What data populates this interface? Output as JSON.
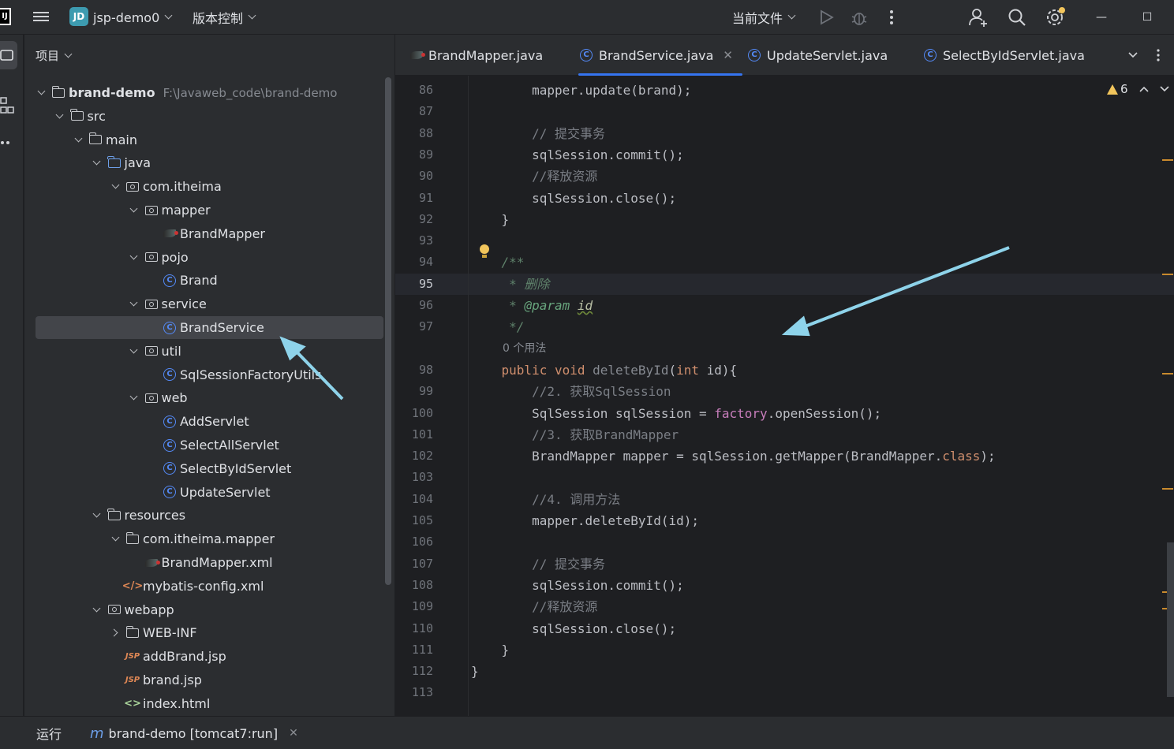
{
  "topbar": {
    "logo": "IJ",
    "project_badge": "JD",
    "project_name": "jsp-demo0",
    "vcs_label": "版本控制",
    "run_config": "当前文件"
  },
  "project_panel": {
    "title": "项目",
    "tree": [
      {
        "label": "brand-demo",
        "hint": "F:\\Javaweb_code\\brand-demo",
        "icon": "module-folder-icon",
        "level": 0,
        "expand": "open",
        "bold": true
      },
      {
        "label": "src",
        "icon": "folder-icon",
        "level": 1,
        "expand": "open"
      },
      {
        "label": "main",
        "icon": "folder-icon",
        "level": 2,
        "expand": "open"
      },
      {
        "label": "java",
        "icon": "source-folder-icon",
        "level": 3,
        "expand": "open"
      },
      {
        "label": "com.itheima",
        "icon": "package-icon",
        "level": 4,
        "expand": "open"
      },
      {
        "label": "mapper",
        "icon": "package-icon",
        "level": 5,
        "expand": "open"
      },
      {
        "label": "BrandMapper",
        "icon": "mybatis-bird-icon",
        "level": 6,
        "expand": "none"
      },
      {
        "label": "pojo",
        "icon": "package-icon",
        "level": 5,
        "expand": "open"
      },
      {
        "label": "Brand",
        "icon": "class-icon",
        "level": 6,
        "expand": "none"
      },
      {
        "label": "service",
        "icon": "package-icon",
        "level": 5,
        "expand": "open"
      },
      {
        "label": "BrandService",
        "icon": "class-icon",
        "level": 6,
        "expand": "none",
        "selected": true
      },
      {
        "label": "util",
        "icon": "package-icon",
        "level": 5,
        "expand": "open"
      },
      {
        "label": "SqlSessionFactoryUtils",
        "icon": "class-icon",
        "level": 6,
        "expand": "none"
      },
      {
        "label": "web",
        "icon": "package-icon",
        "level": 5,
        "expand": "open"
      },
      {
        "label": "AddServlet",
        "icon": "class-icon",
        "level": 6,
        "expand": "none"
      },
      {
        "label": "SelectAllServlet",
        "icon": "class-icon",
        "level": 6,
        "expand": "none"
      },
      {
        "label": "SelectByIdServlet",
        "icon": "class-icon",
        "level": 6,
        "expand": "none"
      },
      {
        "label": "UpdateServlet",
        "icon": "class-icon",
        "level": 6,
        "expand": "none"
      },
      {
        "label": "resources",
        "icon": "resources-folder-icon",
        "level": 3,
        "expand": "open"
      },
      {
        "label": "com.itheima.mapper",
        "icon": "folder-icon",
        "level": 4,
        "expand": "open"
      },
      {
        "label": "BrandMapper.xml",
        "icon": "mybatis-bird-icon",
        "level": 5,
        "expand": "none"
      },
      {
        "label": "mybatis-config.xml",
        "icon": "xml-icon",
        "level": 4,
        "expand": "none"
      },
      {
        "label": "webapp",
        "icon": "web-folder-icon",
        "level": 3,
        "expand": "open"
      },
      {
        "label": "WEB-INF",
        "icon": "folder-icon",
        "level": 4,
        "expand": "closed"
      },
      {
        "label": "addBrand.jsp",
        "icon": "jsp-icon",
        "level": 4,
        "expand": "none"
      },
      {
        "label": "brand.jsp",
        "icon": "jsp-icon",
        "level": 4,
        "expand": "none"
      },
      {
        "label": "index.html",
        "icon": "html-icon",
        "level": 4,
        "expand": "none"
      }
    ]
  },
  "tabs": [
    {
      "label": "BrandMapper.java",
      "icon": "mybatis-bird-icon",
      "active": false
    },
    {
      "label": "BrandService.java",
      "icon": "class-icon",
      "active": true
    },
    {
      "label": "UpdateServlet.java",
      "icon": "class-icon",
      "active": false
    },
    {
      "label": "SelectByIdServlet.java",
      "icon": "class-icon",
      "active": false
    }
  ],
  "editor": {
    "warning_count": "6",
    "usages_hint": "0 个用法",
    "current_line": "95",
    "lines": [
      {
        "n": "86",
        "parts": [
          [
            "",
            "        mapper.update(brand);"
          ]
        ]
      },
      {
        "n": "87",
        "parts": []
      },
      {
        "n": "88",
        "parts": [
          [
            "cmt",
            "        // 提交事务"
          ]
        ]
      },
      {
        "n": "89",
        "parts": [
          [
            "",
            "        sqlSession.commit();"
          ]
        ]
      },
      {
        "n": "90",
        "parts": [
          [
            "cmt",
            "        //释放资源"
          ]
        ]
      },
      {
        "n": "91",
        "parts": [
          [
            "",
            "        sqlSession.close();"
          ]
        ]
      },
      {
        "n": "92",
        "parts": [
          [
            "",
            "    }"
          ]
        ]
      },
      {
        "n": "93",
        "parts": []
      },
      {
        "n": "94",
        "parts": [
          [
            "doc",
            "    /**"
          ]
        ]
      },
      {
        "n": "95",
        "parts": [
          [
            "doc",
            "     * 删除"
          ]
        ]
      },
      {
        "n": "96",
        "parts": [
          [
            "doc",
            "     * "
          ],
          [
            "tag",
            "@param"
          ],
          [
            "doc",
            " "
          ],
          [
            "pid",
            "id"
          ]
        ]
      },
      {
        "n": "97",
        "parts": [
          [
            "doc",
            "     */"
          ]
        ]
      },
      {
        "n": "",
        "parts": []
      },
      {
        "n": "98",
        "parts": [
          [
            "k",
            "    public void "
          ],
          [
            "grey",
            "deleteById"
          ],
          [
            "",
            "("
          ],
          [
            "k",
            "int"
          ],
          [
            "",
            " id){"
          ]
        ]
      },
      {
        "n": "99",
        "parts": [
          [
            "cmt",
            "        //2. 获取SqlSession"
          ]
        ]
      },
      {
        "n": "100",
        "parts": [
          [
            "",
            "        SqlSession sqlSession = "
          ],
          [
            "fld",
            "factory"
          ],
          [
            "",
            ".openSession();"
          ]
        ]
      },
      {
        "n": "101",
        "parts": [
          [
            "cmt",
            "        //3. 获取BrandMapper"
          ]
        ]
      },
      {
        "n": "102",
        "parts": [
          [
            "",
            "        BrandMapper mapper = sqlSession.getMapper(BrandMapper."
          ],
          [
            "k",
            "class"
          ],
          [
            "",
            ");"
          ]
        ]
      },
      {
        "n": "103",
        "parts": []
      },
      {
        "n": "104",
        "parts": [
          [
            "cmt",
            "        //4. 调用方法"
          ]
        ]
      },
      {
        "n": "105",
        "parts": [
          [
            "",
            "        mapper.deleteById(id);"
          ]
        ]
      },
      {
        "n": "106",
        "parts": []
      },
      {
        "n": "107",
        "parts": [
          [
            "cmt",
            "        // 提交事务"
          ]
        ]
      },
      {
        "n": "108",
        "parts": [
          [
            "",
            "        sqlSession.commit();"
          ]
        ]
      },
      {
        "n": "109",
        "parts": [
          [
            "cmt",
            "        //释放资源"
          ]
        ]
      },
      {
        "n": "110",
        "parts": [
          [
            "",
            "        sqlSession.close();"
          ]
        ]
      },
      {
        "n": "111",
        "parts": [
          [
            "",
            "    }"
          ]
        ]
      },
      {
        "n": "112",
        "parts": [
          [
            "",
            "}"
          ]
        ]
      },
      {
        "n": "113",
        "parts": []
      }
    ]
  },
  "bottombar": {
    "run_label": "运行",
    "run_tab": "brand-demo [tomcat7:run]"
  },
  "colors": {
    "accent": "#3574f0",
    "annotation_arrow": "#8ed3ea"
  }
}
